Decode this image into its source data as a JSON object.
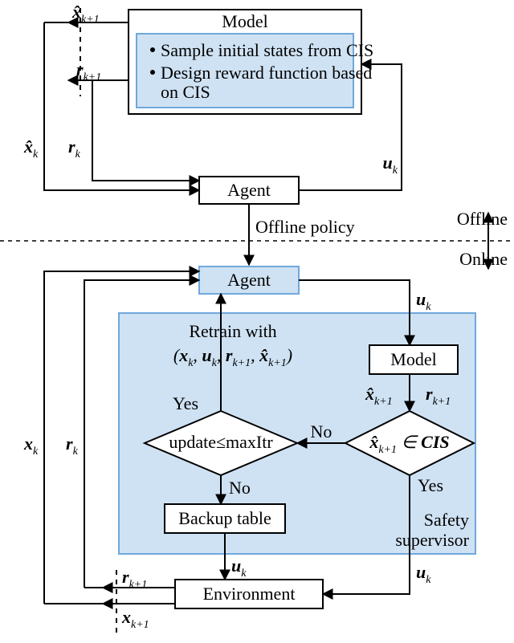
{
  "offline": {
    "model_title": "Model",
    "model_bullets": [
      "Sample initial states from CIS",
      "Design reward function based on CIS"
    ],
    "agent_label": "Agent",
    "outputs": {
      "x_hat_k1": "x̂ₖ₊₁",
      "r_k1": "rₖ₊₁",
      "x_hat_k": "x̂ₖ",
      "r_k": "rₖ",
      "u_k": "uₖ"
    },
    "policy_arrow_label": "Offline policy"
  },
  "divider": {
    "left_label_top": "Offline",
    "left_label_bottom": "Online"
  },
  "online": {
    "agent_label": "Agent",
    "model_label": "Model",
    "supervisor_label": "Safety supervisor",
    "retrain_label": "Retrain with",
    "retrain_tuple": "(xₖ, uₖ, rₖ₊₁, x̂ₖ₊₁)",
    "decision_cis": "x̂ₖ₊₁ ∈ CIS",
    "decision_update": "update≤maxItr",
    "yes": "Yes",
    "no": "No",
    "backup_label": "Backup table",
    "environment_label": "Environment",
    "signals": {
      "u_k": "uₖ",
      "x_hat_k1": "x̂ₖ₊₁",
      "r_k1": "rₖ₊₁",
      "x_k": "xₖ",
      "r_k": "rₖ",
      "x_k1": "xₖ₊₁"
    }
  },
  "colors": {
    "highlight_fill": "#cfe2f3",
    "highlight_stroke": "#6fa8dc",
    "black": "#000000"
  }
}
